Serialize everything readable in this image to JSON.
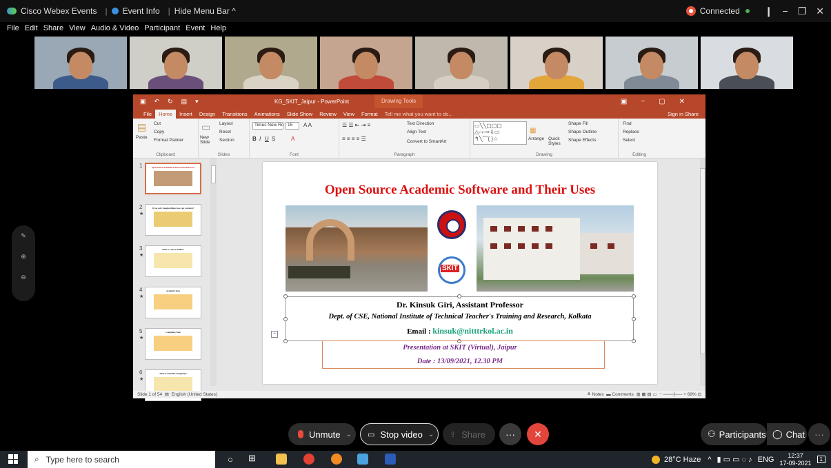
{
  "titlebar": {
    "app_name": "Cisco Webex Events",
    "event_info": "Event Info",
    "hide_menu": "Hide Menu Bar ^",
    "status": "Connected"
  },
  "menubar": [
    "File",
    "Edit",
    "Share",
    "View",
    "Audio & Video",
    "Participant",
    "Event",
    "Help"
  ],
  "videos": [
    {
      "bg": "#9aa7b4",
      "shirt": "#3c5b8a"
    },
    {
      "bg": "#cfcfc7",
      "shirt": "#6a4f7a"
    },
    {
      "bg": "#b1a98d",
      "shirt": "#d9d3c6"
    },
    {
      "bg": "#c5a590",
      "shirt": "#c14b3a"
    },
    {
      "bg": "#bfb8ad",
      "shirt": "#d4cfc2"
    },
    {
      "bg": "#d8d1c8",
      "shirt": "#e3a63a"
    },
    {
      "bg": "#c7ccd0",
      "shirt": "#7f8a96"
    },
    {
      "bg": "#d9dde1",
      "shirt": "#4a4f57"
    }
  ],
  "powerpoint": {
    "file_title": "KG_SKIT_Jaipur - PowerPoint",
    "drawing_tools": "Drawing Tools",
    "tabs": [
      "File",
      "Home",
      "Insert",
      "Design",
      "Transitions",
      "Animations",
      "Slide Show",
      "Review",
      "View",
      "Format"
    ],
    "tell_me": "Tell me what you want to do...",
    "sign_in": "Sign in  Share",
    "ribbon": {
      "clipboard": {
        "paste": "Paste",
        "cut": "Cut",
        "copy": "Copy",
        "format_painter": "Format Painter",
        "label": "Clipboard"
      },
      "slides": {
        "new_slide": "New Slide",
        "layout": "Layout",
        "reset": "Reset",
        "section": "Section",
        "label": "Slides"
      },
      "font": {
        "font_name": "Times New Ro",
        "font_size": "15",
        "label": "Font"
      },
      "paragraph": {
        "text_direction": "Text Direction",
        "align_text": "Align Text",
        "convert_smartart": "Convert to SmartArt",
        "label": "Paragraph"
      },
      "drawing": {
        "arrange": "Arrange",
        "quick_styles": "Quick Styles",
        "shape_fill": "Shape Fill",
        "shape_outline": "Shape Outline",
        "shape_effects": "Shape Effects",
        "label": "Drawing"
      },
      "editing": {
        "find": "Find",
        "replace": "Replace",
        "select": "Select",
        "label": "Editing"
      }
    },
    "thumbnails": [
      {
        "num": "1",
        "title": "Open Source Academic Software and Their Uses"
      },
      {
        "num": "2",
        "title": "If you can't imagine things, how can you learn?"
      },
      {
        "num": "3",
        "title": "What is Course Outline?"
      },
      {
        "num": "4",
        "title": "Academic Tools"
      },
      {
        "num": "5",
        "title": "Computing Tools"
      },
      {
        "num": "6",
        "title": "What is Scientific Computing?"
      }
    ],
    "slide": {
      "title": "Open Source Academic Software and Their Uses",
      "author": "Dr. Kinsuk  Giri, Assistant Professor",
      "dept": "Dept. of CSE, National Institute of Technical Teacher's Training and Research, Kolkata",
      "email_label": "Email : ",
      "email": "kinsuk@nitttrkol.ac.in",
      "presentation": "Presentation at SKIT (Virtual), Jaipur",
      "date": "Date : 13/09/2021, 12.30 PM",
      "skit_logo_text": "SKIT"
    },
    "status": {
      "slide_of": "Slide 1 of 54",
      "language": "English (United States)",
      "notes": "Notes",
      "comments": "Comments",
      "zoom": "69%"
    }
  },
  "callbar": {
    "unmute": "Unmute",
    "stop_video": "Stop video",
    "share": "Share",
    "participants": "Participants",
    "chat": "Chat"
  },
  "taskbar": {
    "search_placeholder": "Type here to search",
    "weather": "28°C Haze",
    "lang": "ENG",
    "time": "12:37",
    "date": "17-09-2021",
    "notifications": "1"
  }
}
